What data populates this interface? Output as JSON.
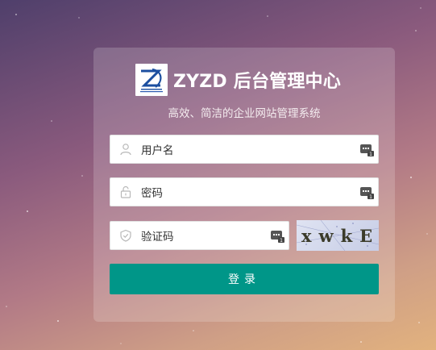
{
  "brand": {
    "title": "ZYZD 后台管理中心",
    "logo_icon": "zyzd-logo-icon"
  },
  "subtitle": "高效、简洁的企业网站管理系统",
  "form": {
    "username": {
      "placeholder": "用户名",
      "icon": "user-icon",
      "keyboard_icon": "keyboard-icon"
    },
    "password": {
      "placeholder": "密码",
      "icon": "lock-icon",
      "keyboard_icon": "keyboard-icon"
    },
    "captcha": {
      "placeholder": "验证码",
      "icon": "shield-icon",
      "keyboard_icon": "keyboard-icon",
      "image_text": "xwkE"
    },
    "submit_label": "登录"
  },
  "colors": {
    "accent": "#009688",
    "background_top": "#4f3f6b",
    "background_bottom": "#e2b27e"
  }
}
